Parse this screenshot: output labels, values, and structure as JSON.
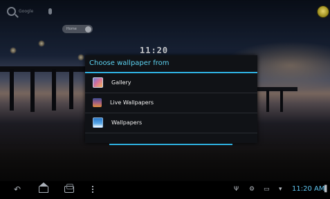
{
  "home": {
    "search_label": "Google",
    "widget_label": "Home",
    "clock_text": "11:20"
  },
  "dialog": {
    "title": "Choose wallpaper from",
    "items": [
      {
        "label": "Gallery",
        "icon": "gallery-icon"
      },
      {
        "label": "Live Wallpapers",
        "icon": "live-wallpapers-icon"
      },
      {
        "label": "Wallpapers",
        "icon": "wallpapers-icon"
      }
    ],
    "accent_color": "#33b5e5"
  },
  "status_bar": {
    "time": "11:20 AM",
    "icons": [
      "usb-icon",
      "settings-icon",
      "screenshot-icon",
      "wifi-icon",
      "battery-icon"
    ]
  },
  "nav_bar": {
    "buttons": [
      "back-icon",
      "home-icon",
      "recent-apps-icon",
      "menu-icon"
    ]
  }
}
